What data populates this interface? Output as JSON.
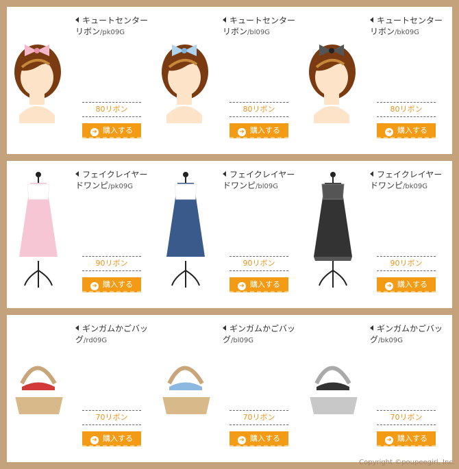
{
  "items": [
    {
      "name": "キュートセンターリボン",
      "code": "/pk09G",
      "price": "80リボン",
      "buy": "購入する",
      "kind": "hair",
      "color": "#f4b8c9"
    },
    {
      "name": "キュートセンターリボン",
      "code": "/bl09G",
      "price": "80リボン",
      "buy": "購入する",
      "kind": "hair",
      "color": "#aed3ef"
    },
    {
      "name": "キュートセンターリボン",
      "code": "/bk09G",
      "price": "80リボン",
      "buy": "購入する",
      "kind": "hair",
      "color": "#555555"
    },
    {
      "name": "フェイクレイヤードワンピ",
      "code": "/pk09G",
      "price": "90リボン",
      "buy": "購入する",
      "kind": "dress",
      "color": "#f7c6d4"
    },
    {
      "name": "フェイクレイヤードワンピ",
      "code": "/bl09G",
      "price": "90リボン",
      "buy": "購入する",
      "kind": "dress",
      "color": "#3a5a8c"
    },
    {
      "name": "フェイクレイヤードワンピ",
      "code": "/bk09G",
      "price": "90リボン",
      "buy": "購入する",
      "kind": "dress",
      "color": "#333333"
    },
    {
      "name": "ギンガムかごバッグ",
      "code": "/rd09G",
      "price": "70リボン",
      "buy": "購入する",
      "kind": "bag",
      "color": "#d23a3a"
    },
    {
      "name": "ギンガムかごバッグ",
      "code": "/bl09G",
      "price": "70リボン",
      "buy": "購入する",
      "kind": "bag",
      "color": "#8db8e0"
    },
    {
      "name": "ギンガムかごバッグ",
      "code": "/bk09G",
      "price": "70リボン",
      "buy": "購入する",
      "kind": "bag",
      "color": "#333333"
    }
  ],
  "copyright": "Copyright ©poupeegirl, Inc."
}
